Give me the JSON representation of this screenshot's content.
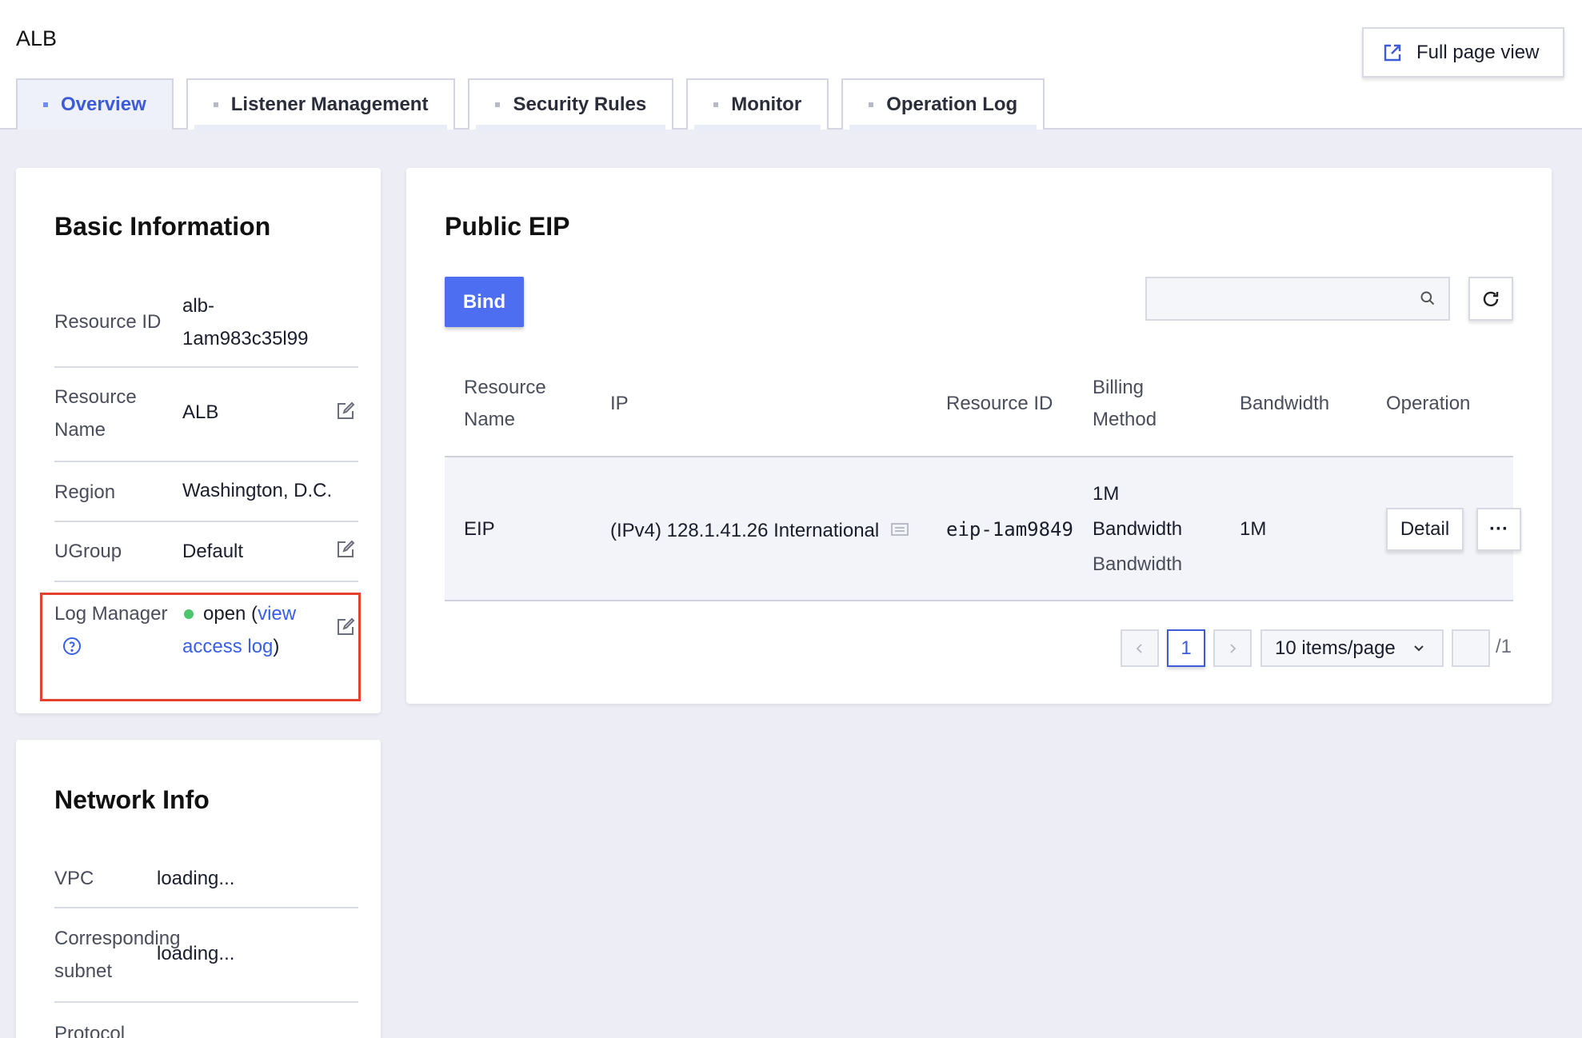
{
  "app": {
    "title": "ALB",
    "full_page_label": "Full page view"
  },
  "tabs": [
    {
      "label": "Overview"
    },
    {
      "label": "Listener Management"
    },
    {
      "label": "Security Rules"
    },
    {
      "label": "Monitor"
    },
    {
      "label": "Operation Log"
    }
  ],
  "basic_info": {
    "title": "Basic Information",
    "resource_id": {
      "label": "Resource ID",
      "value_line1": "alb-",
      "value_line2": "1am983c35l99"
    },
    "resource_name": {
      "label_line1": "Resource",
      "label_line2": "Name",
      "value": "ALB"
    },
    "region": {
      "label": "Region",
      "value": "Washington, D.C."
    },
    "ugroup": {
      "label": "UGroup",
      "value": "Default"
    },
    "log_manager": {
      "label": "Log Manager",
      "status": "open (",
      "link_line1": "view",
      "link_line2": "access log",
      "close_paren": ")"
    }
  },
  "network_info": {
    "title": "Network Info",
    "vpc": {
      "label": "VPC",
      "value": "loading..."
    },
    "subnet": {
      "label_line1": "Corresponding",
      "label_line2": "subnet",
      "value": "loading..."
    },
    "protocol": {
      "label": "Protocol"
    }
  },
  "public_eip": {
    "title": "Public EIP",
    "bind_label": "Bind",
    "search_placeholder": "",
    "columns": {
      "resource_name_line1": "Resource",
      "resource_name_line2": "Name",
      "ip": "IP",
      "resource_id": "Resource ID",
      "billing_line1": "Billing",
      "billing_line2": "Method",
      "bandwidth": "Bandwidth",
      "operation": "Operation"
    },
    "rows": [
      {
        "resource_name": "EIP",
        "ip": "(IPv4) 128.1.41.26 International",
        "resource_id": "eip-1am9849",
        "billing_line1": "1M",
        "billing_line2": "Bandwidth",
        "billing_line3": "Bandwidth",
        "bandwidth": "1M",
        "detail_label": "Detail",
        "more_label": "···"
      }
    ],
    "pagination": {
      "current_page": "1",
      "page_size": "10 items/page",
      "total": "/1"
    }
  },
  "colors": {
    "accent": "#4d6ef0",
    "link": "#3860e6",
    "status_open": "#4cc56b",
    "highlight": "#e5412f",
    "background": "#edeef5"
  }
}
